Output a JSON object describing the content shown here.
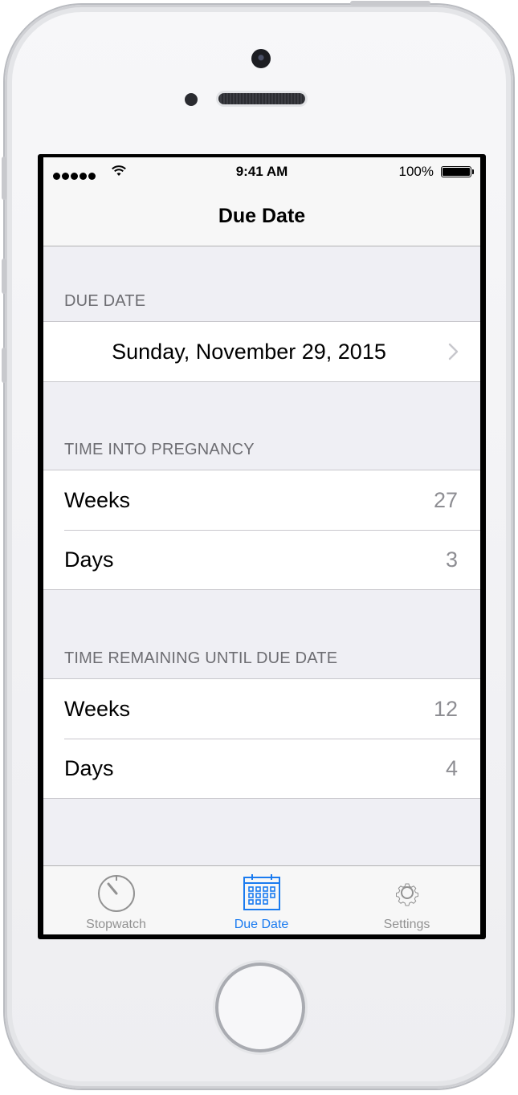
{
  "status_bar": {
    "time": "9:41 AM",
    "battery": "100%"
  },
  "nav": {
    "title": "Due Date"
  },
  "sections": {
    "due_date": {
      "header": "DUE DATE",
      "date": "Sunday, November 29, 2015"
    },
    "pregnancy": {
      "header": "TIME INTO PREGNANCY",
      "rows": [
        {
          "label": "Weeks",
          "value": "27"
        },
        {
          "label": "Days",
          "value": "3"
        }
      ]
    },
    "remaining": {
      "header": "TIME REMAINING UNTIL DUE DATE",
      "rows": [
        {
          "label": "Weeks",
          "value": "12"
        },
        {
          "label": "Days",
          "value": "4"
        }
      ]
    }
  },
  "tabs": [
    {
      "label": "Stopwatch",
      "icon": "stopwatch-icon",
      "active": false
    },
    {
      "label": "Due Date",
      "icon": "calendar-icon",
      "active": true
    },
    {
      "label": "Settings",
      "icon": "gear-icon",
      "active": false
    }
  ],
  "colors": {
    "accent": "#1a7bf0",
    "background": "#efeff4",
    "inactive_tab": "#929292"
  }
}
